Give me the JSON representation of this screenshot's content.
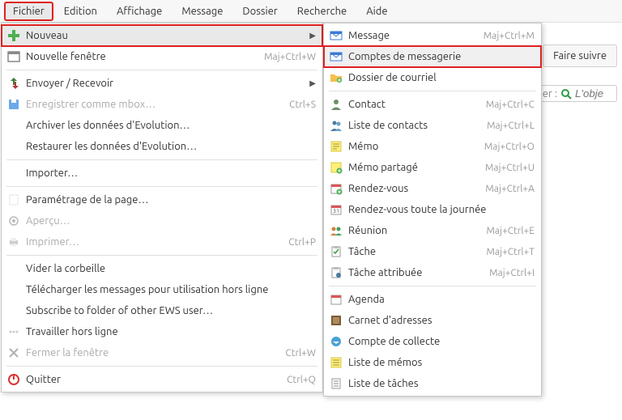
{
  "menubar": {
    "items": [
      {
        "label": "Fichier",
        "active": true,
        "highlight": true
      },
      {
        "label": "Edition"
      },
      {
        "label": "Affichage"
      },
      {
        "label": "Message"
      },
      {
        "label": "Dossier"
      },
      {
        "label": "Recherche"
      },
      {
        "label": "Aide"
      }
    ]
  },
  "file_menu": [
    {
      "icon": "plus-green",
      "label": "Nouveau",
      "submenu": true,
      "active": true,
      "highlight": true
    },
    {
      "icon": "window",
      "label": "Nouvelle fenêtre",
      "shortcut": "Maj+Ctrl+W"
    },
    {
      "sep": true
    },
    {
      "icon": "sendrecv",
      "label": "Envoyer / Recevoir",
      "submenu": true
    },
    {
      "icon": "save-blue",
      "label": "Enregistrer comme mbox…",
      "shortcut": "Ctrl+S",
      "disabled": true
    },
    {
      "icon": "",
      "label": "Archiver les données d'Evolution…"
    },
    {
      "icon": "",
      "label": "Restaurer les données d'Evolution…"
    },
    {
      "sep": true
    },
    {
      "icon": "",
      "label": "Importer…"
    },
    {
      "sep": true
    },
    {
      "icon": "page-dots",
      "label": "Paramétrage de la page…"
    },
    {
      "icon": "preview-gray",
      "label": "Aperçu…",
      "disabled": true
    },
    {
      "icon": "print-gray",
      "label": "Imprimer…",
      "shortcut": "Ctrl+P",
      "disabled": true
    },
    {
      "sep": true
    },
    {
      "icon": "",
      "label": "Vider la corbeille"
    },
    {
      "icon": "",
      "label": "Télécharger les messages pour utilisation hors ligne"
    },
    {
      "icon": "",
      "label": "Subscribe to folder of other EWS user…"
    },
    {
      "icon": "offline-dots",
      "label": "Travailler hors ligne"
    },
    {
      "icon": "close-x",
      "label": "Fermer la fenêtre",
      "shortcut": "Ctrl+W",
      "disabled": true
    },
    {
      "sep": true
    },
    {
      "icon": "power-red",
      "label": "Quitter",
      "shortcut": "Ctrl+Q"
    }
  ],
  "submenu": [
    {
      "icon": "mail",
      "label": "Message",
      "shortcut": "Maj+Ctrl+M"
    },
    {
      "icon": "mail",
      "label": "Comptes de messagerie",
      "selected": true,
      "highlight": true
    },
    {
      "icon": "folder-plus",
      "label": "Dossier de courriel"
    },
    {
      "sep": true
    },
    {
      "icon": "contact",
      "label": "Contact",
      "shortcut": "Maj+Ctrl+C"
    },
    {
      "icon": "contact2",
      "label": "Liste de contacts",
      "shortcut": "Maj+Ctrl+L"
    },
    {
      "icon": "memo",
      "label": "Mémo",
      "shortcut": "Maj+Ctrl+O"
    },
    {
      "icon": "memo-plus",
      "label": "Mémo partagé",
      "shortcut": "Maj+Ctrl+U"
    },
    {
      "icon": "calendar-plus",
      "label": "Rendez-vous",
      "shortcut": "Maj+Ctrl+A"
    },
    {
      "icon": "calendar",
      "label": "Rendez-vous toute la journée"
    },
    {
      "icon": "people",
      "label": "Réunion",
      "shortcut": "Maj+Ctrl+E"
    },
    {
      "icon": "task",
      "label": "Tâche",
      "shortcut": "Maj+Ctrl+T"
    },
    {
      "icon": "task-assigned",
      "label": "Tâche attribuée",
      "shortcut": "Maj+Ctrl+I"
    },
    {
      "sep": true
    },
    {
      "icon": "agenda",
      "label": "Agenda"
    },
    {
      "icon": "addressbook",
      "label": "Carnet d'adresses"
    },
    {
      "icon": "collect",
      "label": "Compte de collecte"
    },
    {
      "icon": "memo-list",
      "label": "Liste de mémos"
    },
    {
      "icon": "task-list",
      "label": "Liste de tâches"
    }
  ],
  "toolbar": {
    "forward": "Faire suivre"
  },
  "search": {
    "prefix": "cher :",
    "placeholder": "L'obje"
  }
}
